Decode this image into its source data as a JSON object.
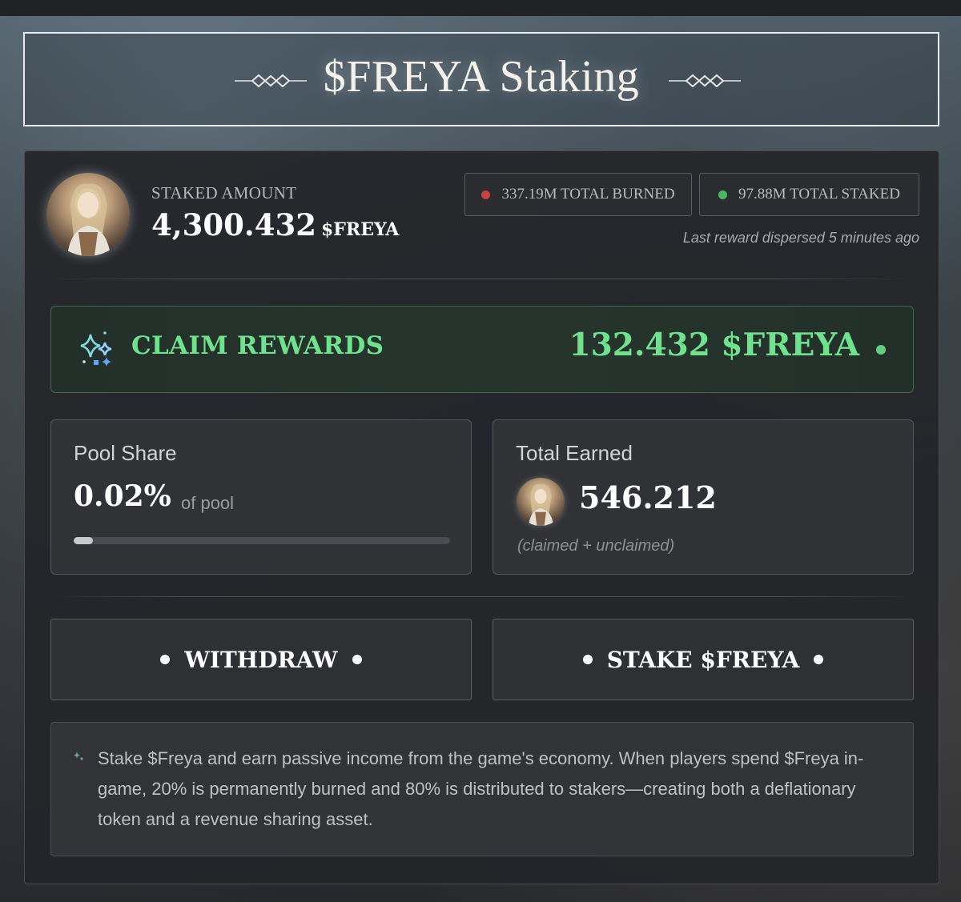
{
  "header": {
    "title": "$FREYA Staking"
  },
  "staked": {
    "label": "STAKED AMOUNT",
    "amount": "4,300.432",
    "unit": "$FREYA",
    "avatar_icon": "character-portrait"
  },
  "stats": {
    "burned": "337.19M TOTAL BURNED",
    "staked": "97.88M TOTAL STAKED",
    "burned_color": "#d9534f",
    "staked_color": "#4cc266",
    "last_reward": "Last reward dispersed 5 minutes ago"
  },
  "claim": {
    "label": "CLAIM REWARDS",
    "amount": "132.432 $FREYA",
    "icon": "sparkle-icon",
    "accent_color": "#6fe28e"
  },
  "pool_share": {
    "title": "Pool Share",
    "value": "0.02%",
    "suffix": "of pool",
    "progress": 0.05
  },
  "total_earned": {
    "title": "Total Earned",
    "value": "546.212",
    "note": "(claimed + unclaimed)"
  },
  "actions": {
    "withdraw": "WITHDRAW",
    "stake": "STAKE $FREYA"
  },
  "info": {
    "text": "Stake $Freya and earn passive income from the game's economy. When players spend $Freya in-game, 20% is permanently burned and 80% is distributed to stakers—creating both a deflationary token and a revenue sharing asset."
  }
}
